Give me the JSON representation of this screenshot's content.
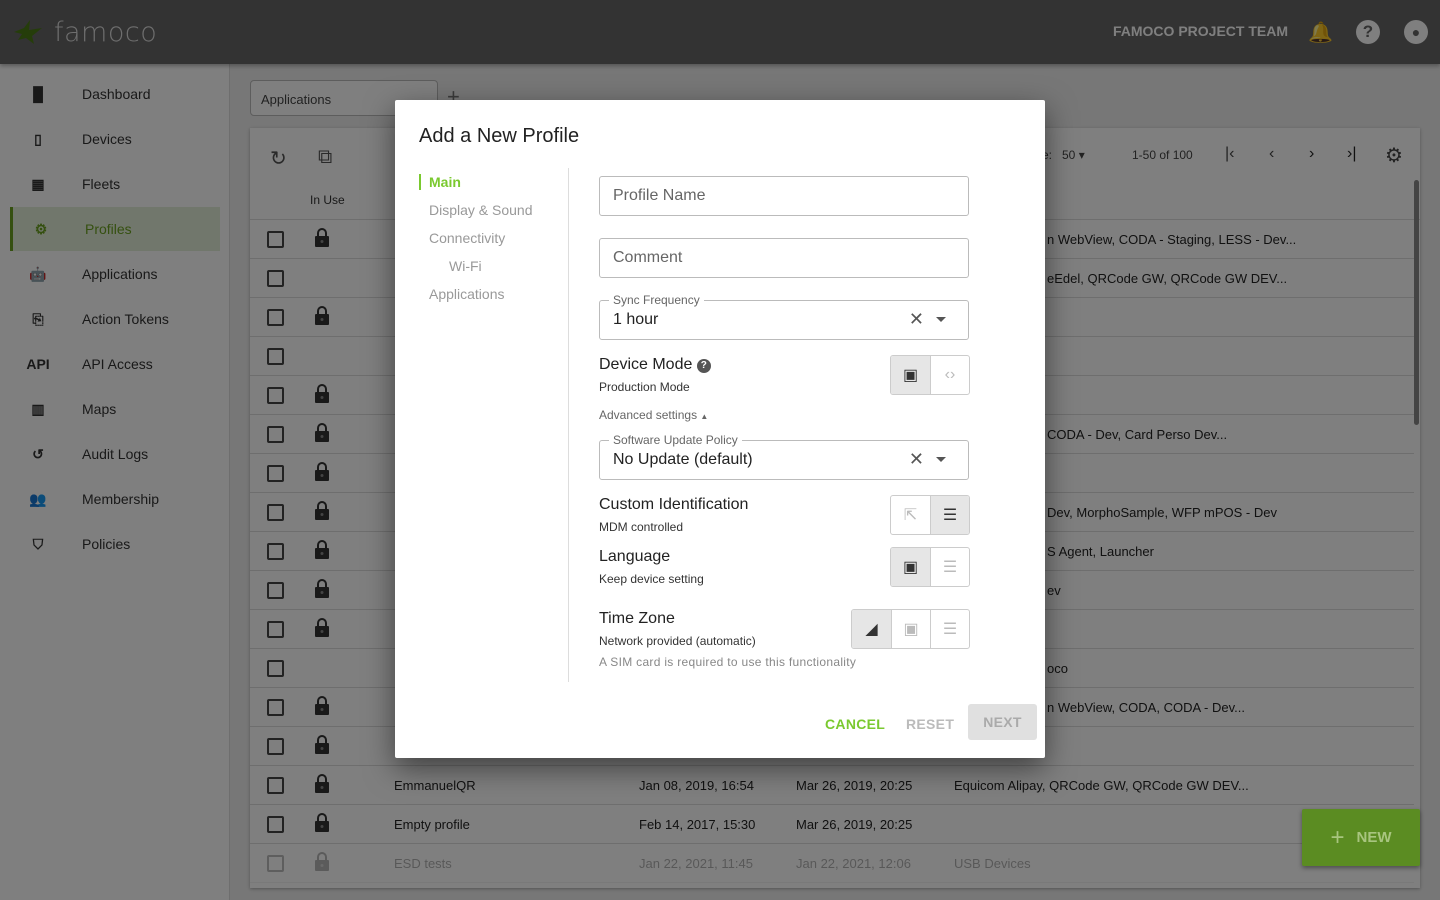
{
  "header": {
    "brand": "famoco",
    "team": "FAMOCO PROJECT TEAM",
    "icons": [
      "bell-icon",
      "help-icon",
      "account-icon"
    ]
  },
  "sidebar": {
    "items": [
      {
        "label": "Dashboard",
        "icon": "▐▌"
      },
      {
        "label": "Devices",
        "icon": "▯"
      },
      {
        "label": "Fleets",
        "icon": "▦"
      },
      {
        "label": "Profiles",
        "icon": "⚙"
      },
      {
        "label": "Applications",
        "icon": "🤖"
      },
      {
        "label": "Action Tokens",
        "icon": "⎘"
      },
      {
        "label": "API Access",
        "icon": "API"
      },
      {
        "label": "Maps",
        "icon": "▥"
      },
      {
        "label": "Audit Logs",
        "icon": "↺"
      },
      {
        "label": "Membership",
        "icon": "👥"
      },
      {
        "label": "Policies",
        "icon": "⛉"
      }
    ],
    "active": "Profiles"
  },
  "main": {
    "tab_select": "Applications",
    "column_in_use": "In Use",
    "page_size_label": "e:",
    "page_size": "50",
    "range": "1-50 of 100",
    "rows": [
      {
        "lock": true,
        "name": "",
        "created": "",
        "modified": "",
        "apps": "n WebView, CODA - Staging, LESS - Dev..."
      },
      {
        "lock": false,
        "name": "",
        "created": "",
        "modified": "",
        "apps": "eEdel, QRCode GW, QRCode GW DEV..."
      },
      {
        "lock": true,
        "name": "",
        "created": "",
        "modified": "",
        "apps": ""
      },
      {
        "lock": false,
        "name": "",
        "created": "",
        "modified": "",
        "apps": ""
      },
      {
        "lock": true,
        "name": "",
        "created": "",
        "modified": "",
        "apps": ""
      },
      {
        "lock": true,
        "name": "",
        "created": "",
        "modified": "",
        "apps": "CODA - Dev, Card Perso Dev..."
      },
      {
        "lock": true,
        "name": "",
        "created": "",
        "modified": "",
        "apps": ""
      },
      {
        "lock": true,
        "name": "",
        "created": "",
        "modified": "",
        "apps": "Dev, MorphoSample, WFP mPOS - Dev"
      },
      {
        "lock": true,
        "name": "",
        "created": "",
        "modified": "",
        "apps": "S Agent, Launcher"
      },
      {
        "lock": true,
        "name": "",
        "created": "",
        "modified": "",
        "apps": "ev"
      },
      {
        "lock": true,
        "name": "",
        "created": "",
        "modified": "",
        "apps": ""
      },
      {
        "lock": false,
        "name": "",
        "created": "",
        "modified": "",
        "apps": "oco"
      },
      {
        "lock": true,
        "name": "",
        "created": "",
        "modified": "",
        "apps": "n WebView, CODA, CODA - Dev..."
      },
      {
        "lock": true,
        "name": "",
        "created": "",
        "modified": "",
        "apps": ""
      },
      {
        "lock": true,
        "name": "EmmanuelQR",
        "created": "Jan 08, 2019, 16:54",
        "modified": "Mar 26, 2019, 20:25",
        "apps": "Equicom Alipay, QRCode GW, QRCode GW DEV..."
      },
      {
        "lock": true,
        "name": "Empty profile",
        "created": "Feb 14, 2017, 15:30",
        "modified": "Mar 26, 2019, 20:25",
        "apps": ""
      },
      {
        "lock": true,
        "name": "ESD tests",
        "created": "Jan 22, 2021, 11:45",
        "modified": "Jan 22, 2021, 12:06",
        "apps": "USB Devices"
      }
    ],
    "new_label": "NEW"
  },
  "modal": {
    "title": "Add a New Profile",
    "nav": [
      "Main",
      "Display & Sound",
      "Connectivity",
      "Wi-Fi",
      "Applications"
    ],
    "profile_name_placeholder": "Profile Name",
    "comment_placeholder": "Comment",
    "sync_label": "Sync Frequency",
    "sync_value": "1 hour",
    "device_mode": {
      "title": "Device Mode",
      "value": "Production Mode"
    },
    "advanced": "Advanced settings",
    "update_label": "Software Update Policy",
    "update_value": "No Update (default)",
    "custom_id": {
      "title": "Custom Identification",
      "value": "MDM controlled"
    },
    "language": {
      "title": "Language",
      "value": "Keep device setting"
    },
    "timezone": {
      "title": "Time Zone",
      "value": "Network provided (automatic)",
      "note": "A SIM card is required to use this functionality"
    },
    "cancel": "CANCEL",
    "reset": "RESET",
    "next": "NEXT",
    "accent": "#7ac92f"
  }
}
